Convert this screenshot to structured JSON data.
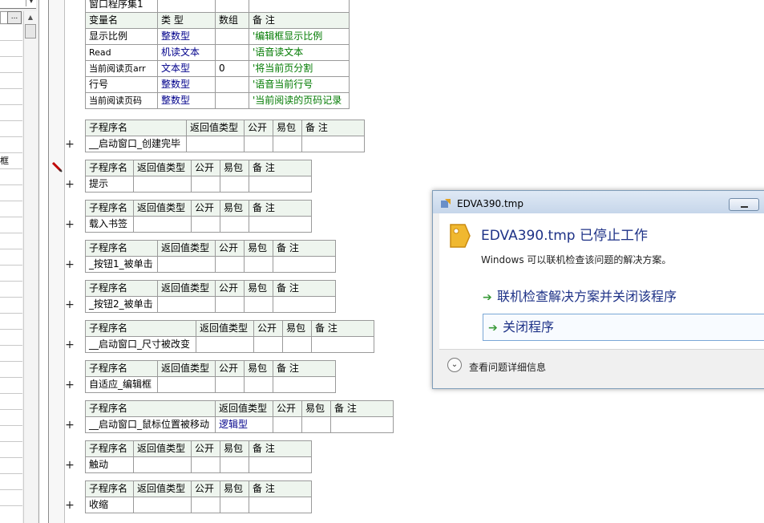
{
  "left_panel": {
    "rows": [
      "",
      "",
      "",
      "",
      "",
      "",
      "",
      "",
      "框",
      "",
      "",
      "",
      "",
      "",
      "",
      "",
      "",
      "",
      "",
      "",
      "",
      "",
      "",
      "",
      "",
      "",
      "",
      "",
      "",
      ""
    ],
    "dots_label": "..."
  },
  "class_table": {
    "header_name": "窗口程序集1",
    "columns": [
      "变量名",
      "类 型",
      "数组",
      "备 注"
    ],
    "rows": [
      {
        "name": "显示比例",
        "type": "整数型",
        "array": "",
        "comment": "'编辑框显示比例"
      },
      {
        "name": "Read",
        "type": "机读文本",
        "array": "",
        "comment": "'语音读文本"
      },
      {
        "name": "当前阅读页arr",
        "type": "文本型",
        "array": "0",
        "comment": "'将当前页分割"
      },
      {
        "name": "行号",
        "type": "整数型",
        "array": "",
        "comment": "'语音当前行号"
      },
      {
        "name": "当前阅读页码",
        "type": "整数型",
        "array": "",
        "comment": "'当前阅读的页码记录"
      }
    ]
  },
  "sub_header": {
    "name": "子程序名",
    "ret": "返回值类型",
    "public": "公开",
    "easy": "易包",
    "comment": "备 注"
  },
  "subs": [
    {
      "name": "__启动窗口_创建完毕",
      "ret": ""
    },
    {
      "name": "提示",
      "ret": ""
    },
    {
      "name": "载入书签",
      "ret": ""
    },
    {
      "name": "_按钮1_被单击",
      "ret": ""
    },
    {
      "name": "_按钮2_被单击",
      "ret": ""
    },
    {
      "name": "__启动窗口_尺寸被改变",
      "ret": ""
    },
    {
      "name": "自适应_编辑框",
      "ret": ""
    },
    {
      "name": "__启动窗口_鼠标位置被移动",
      "ret": "逻辑型"
    },
    {
      "name": "触动",
      "ret": ""
    },
    {
      "name": "收缩",
      "ret": ""
    }
  ],
  "plus_symbol": "+",
  "dialog": {
    "title": "EDVA390.tmp",
    "heading": "EDVA390.tmp 已停止工作",
    "subtitle": "Windows 可以联机检查该问题的解决方案。",
    "option_online": "联机检查解决方案并关闭该程序",
    "option_close": "关闭程序",
    "details": "查看问题详细信息"
  }
}
